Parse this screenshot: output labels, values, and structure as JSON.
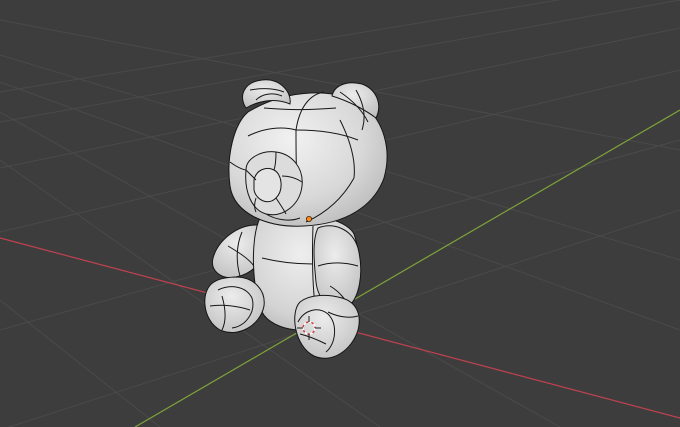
{
  "viewport": {
    "background": "#3d3d3d",
    "grid_color": "#4a4a4a",
    "x_axis_color": "#c0424f",
    "y_axis_color": "#7fa33a",
    "object_color": "#d9d9d9",
    "wire_color": "#161616",
    "origin_color": "#ff8a1f",
    "object": "teddy-bear-mesh",
    "origin_icon": "object-origin-icon",
    "cursor_icon": "3d-cursor-icon"
  }
}
